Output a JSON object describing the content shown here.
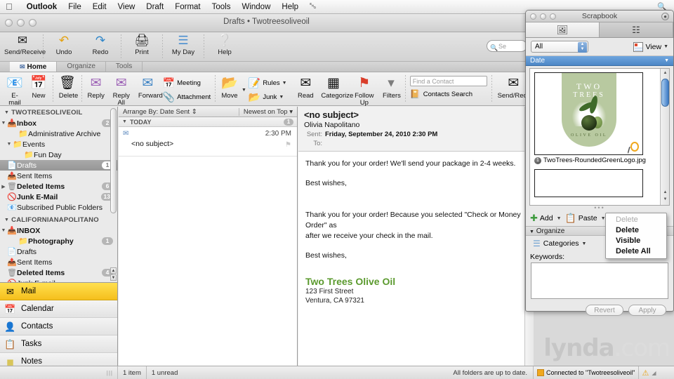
{
  "menubar": {
    "apple": "apple-logo",
    "items": [
      "Outlook",
      "File",
      "Edit",
      "View",
      "Draft",
      "Format",
      "Tools",
      "Window",
      "Help"
    ],
    "right_icon": "bluetooth-icon"
  },
  "window": {
    "title": "Drafts • Twotreesoliveoil",
    "toolbar": [
      {
        "label": "Send/Receive",
        "icon": "send-receive-icon"
      },
      {
        "label": "Undo",
        "icon": "undo-icon"
      },
      {
        "label": "Redo",
        "icon": "redo-icon"
      },
      {
        "label": "Print",
        "icon": "printer-icon"
      },
      {
        "label": "My Day",
        "icon": "my-day-icon"
      },
      {
        "label": "Help",
        "icon": "help-icon"
      }
    ],
    "search_placeholder": "Se",
    "tabs": [
      {
        "label": "Home",
        "active": true
      },
      {
        "label": "Organize",
        "active": false
      },
      {
        "label": "Tools",
        "active": false
      }
    ]
  },
  "ribbon": {
    "group1": [
      {
        "label": "E-mail",
        "icon": "new-email-icon"
      },
      {
        "label": "New",
        "icon": "new-item-icon"
      }
    ],
    "group2": [
      {
        "label": "Delete",
        "icon": "trash-icon"
      }
    ],
    "group3": [
      {
        "label": "Reply",
        "icon": "reply-icon"
      },
      {
        "label": "Reply All",
        "icon": "reply-all-icon"
      },
      {
        "label": "Forward",
        "icon": "forward-icon"
      }
    ],
    "group4": [
      {
        "label": "Meeting",
        "icon": "meeting-icon"
      },
      {
        "label": "Attachment",
        "icon": "attachment-icon"
      }
    ],
    "group5": [
      {
        "label": "Move",
        "icon": "move-folder-icon"
      }
    ],
    "group6": [
      {
        "label": "Rules",
        "icon": "rules-icon"
      },
      {
        "label": "Junk",
        "icon": "junk-icon"
      }
    ],
    "group7": [
      {
        "label": "Read",
        "icon": "read-icon"
      },
      {
        "label": "Categorize",
        "icon": "categorize-icon"
      },
      {
        "label": "Follow Up",
        "icon": "flag-icon"
      },
      {
        "label": "Filters",
        "icon": "filter-icon"
      }
    ],
    "find_contact_placeholder": "Find a Contact",
    "contacts_search_label": "Contacts Search",
    "send_receive_label": "Send/Receive"
  },
  "sidebar": {
    "account1": {
      "name": "TWOTREESOLIVEOIL",
      "folders": [
        {
          "label": "Inbox",
          "badge": "2",
          "icon": "inbox-icon",
          "indent": 1,
          "bold": true,
          "twisty": "down",
          "selected": false
        },
        {
          "label": "Administrative Archive",
          "badge": "",
          "icon": "folder-icon",
          "indent": 3,
          "bold": false,
          "twisty": "",
          "selected": false
        },
        {
          "label": "Events",
          "badge": "",
          "icon": "folder-icon",
          "indent": 2,
          "bold": false,
          "twisty": "down",
          "selected": false
        },
        {
          "label": "Fun Day",
          "badge": "",
          "icon": "folder-icon",
          "indent": 4,
          "bold": false,
          "twisty": "",
          "selected": false
        },
        {
          "label": "Drafts",
          "badge": "1",
          "icon": "drafts-icon",
          "indent": 1,
          "bold": false,
          "twisty": "",
          "selected": true
        },
        {
          "label": "Sent Items",
          "badge": "",
          "icon": "sent-icon",
          "indent": 1,
          "bold": false,
          "twisty": "",
          "selected": false
        },
        {
          "label": "Deleted Items",
          "badge": "6",
          "icon": "deleted-icon",
          "indent": 1,
          "bold": true,
          "twisty": "right",
          "selected": false
        },
        {
          "label": "Junk E-Mail",
          "badge": "13",
          "icon": "junk-icon",
          "indent": 1,
          "bold": true,
          "twisty": "",
          "selected": false
        },
        {
          "label": "Subscribed Public Folders",
          "badge": "",
          "icon": "public-folders-icon",
          "indent": 1,
          "bold": false,
          "twisty": "",
          "selected": false
        }
      ]
    },
    "account2": {
      "name": "CALIFORNIANAPOLITANO",
      "folders": [
        {
          "label": "INBOX",
          "badge": "",
          "icon": "inbox-icon",
          "indent": 1,
          "bold": true,
          "twisty": "down",
          "selected": false
        },
        {
          "label": "Photography",
          "badge": "1",
          "icon": "folder-icon",
          "indent": 3,
          "bold": true,
          "twisty": "",
          "selected": false
        },
        {
          "label": "Drafts",
          "badge": "",
          "icon": "drafts-icon",
          "indent": 1,
          "bold": false,
          "twisty": "",
          "selected": false
        },
        {
          "label": "Sent Items",
          "badge": "",
          "icon": "sent-icon",
          "indent": 1,
          "bold": false,
          "twisty": "",
          "selected": false
        },
        {
          "label": "Deleted Items",
          "badge": "4",
          "icon": "deleted-icon",
          "indent": 1,
          "bold": true,
          "twisty": "",
          "selected": false
        },
        {
          "label": "Junk E-mail",
          "badge": "",
          "icon": "junk-icon",
          "indent": 1,
          "bold": false,
          "twisty": "",
          "selected": false
        }
      ]
    },
    "nav": [
      {
        "label": "Mail",
        "icon": "mail-icon",
        "active": true
      },
      {
        "label": "Calendar",
        "icon": "calendar-icon",
        "active": false
      },
      {
        "label": "Contacts",
        "icon": "contacts-icon",
        "active": false
      },
      {
        "label": "Tasks",
        "icon": "tasks-icon",
        "active": false
      },
      {
        "label": "Notes",
        "icon": "notes-icon",
        "active": false
      }
    ]
  },
  "messagelist": {
    "arrange_by": "Arrange By: Date Sent",
    "sort_order": "Newest on Top",
    "group_label": "TODAY",
    "group_count": "1",
    "rows": [
      {
        "subject": "<no subject>",
        "time": "2:30 PM"
      }
    ]
  },
  "reading": {
    "subject": "<no subject>",
    "from": "Olivia Napolitano",
    "sent_label": "Sent:",
    "sent_value": "Friday, September 24, 2010 2:30 PM",
    "to_label": "To:",
    "to_value": "",
    "paragraphs": [
      "Thank you for your order! We'll send your package in 2-4 weeks.",
      "Best wishes,",
      "Thank you for your order! Because you selected \"Check or Money Order\" as",
      "after we receive your check in the mail.",
      "Best wishes,"
    ],
    "signature": {
      "company": "Two Trees Olive Oil",
      "street": "123 First Street",
      "city": "Ventura, CA 97321"
    }
  },
  "status": {
    "item_count": "1 item",
    "unread": "1 unread",
    "sync": "All folders are up to date.",
    "connected": "Connected to \"Twotreesoliveoil\"",
    "warning_icon": "warning-icon"
  },
  "scrapbook": {
    "title": "Scrapbook",
    "tabs": [
      {
        "icon": "scrapbook-clippings-icon",
        "active": true
      },
      {
        "icon": "scrapbook-tools-icon",
        "active": false
      }
    ],
    "filter_value": "All",
    "view_label": "View",
    "date_header": "Date",
    "items": [
      {
        "caption": "TwoTrees-RoundedGreenLogo.jpg",
        "logo_top": "TWO",
        "logo_mid": "TREES",
        "logo_bottom": "OLIVE OIL"
      }
    ],
    "toolbar": [
      {
        "label": "Add",
        "icon": "add-plus-icon"
      },
      {
        "label": "Paste",
        "icon": "paste-icon"
      },
      {
        "label": "Delete",
        "icon": "delete-trash-icon"
      }
    ],
    "dropdown": {
      "items": [
        {
          "label": "Delete",
          "disabled": true
        },
        {
          "label": "Delete Visible",
          "disabled": false
        },
        {
          "label": "Delete All",
          "disabled": false
        }
      ]
    },
    "organize_label": "Organize",
    "categories_label": "Categories",
    "keywords_label": "Keywords:",
    "keywords_value": "",
    "revert_label": "Revert",
    "apply_label": "Apply"
  },
  "watermark": {
    "bold": "lynda",
    "light": ".com"
  },
  "colors": {
    "accent_yellow": "#f5bf1c",
    "accent_blue": "#4d87c6",
    "brand_green": "#5b9a2e",
    "logo_panel_green": "#b8c9a0"
  }
}
